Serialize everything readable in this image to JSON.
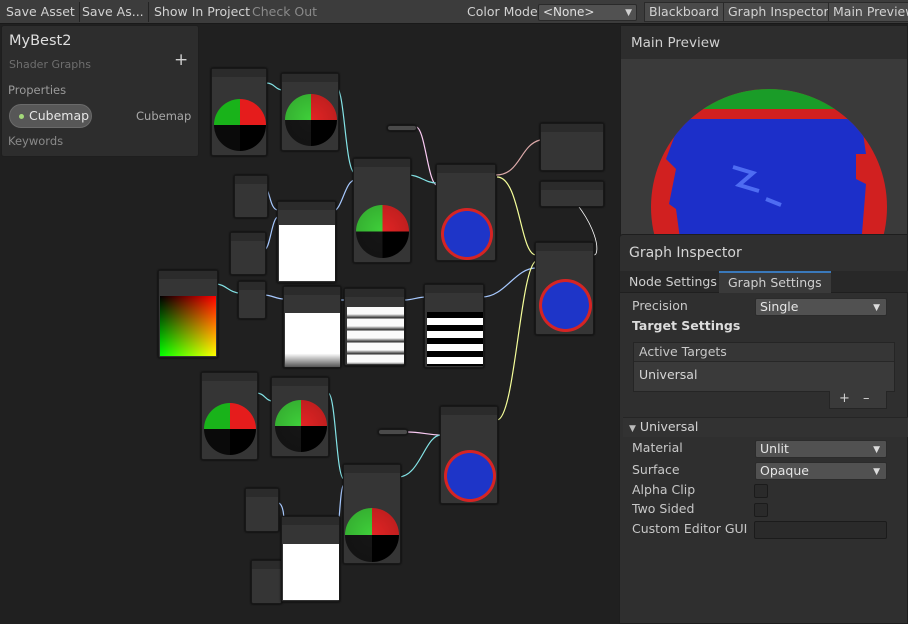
{
  "toolbar": {
    "save_asset": "Save Asset",
    "save_as": "Save As...",
    "show_in_project": "Show In Project",
    "check_out": "Check Out",
    "color_mode_label": "Color Mode",
    "color_mode_value": "<None>",
    "blackboard": "Blackboard",
    "graph_inspector": "Graph Inspector",
    "main_preview": "Main Preview"
  },
  "blackboard": {
    "title": "MyBest2",
    "subtitle": "Shader Graphs",
    "add_icon": "plus-icon",
    "properties_label": "Properties",
    "property": {
      "name": "Cubemap",
      "type": "Cubemap"
    },
    "keywords_label": "Keywords"
  },
  "main_preview": {
    "title": "Main Preview"
  },
  "inspector": {
    "title": "Graph Inspector",
    "tabs": [
      "Node Settings",
      "Graph Settings"
    ],
    "active_tab": "Graph Settings",
    "precision_label": "Precision",
    "precision_value": "Single",
    "target_settings_label": "Target Settings",
    "active_targets_label": "Active Targets",
    "active_targets": [
      "Universal"
    ],
    "add_label": "+",
    "remove_label": "–",
    "section_title": "Universal",
    "material_label": "Material",
    "material_value": "Unlit",
    "surface_label": "Surface",
    "surface_value": "Opaque",
    "alpha_clip_label": "Alpha Clip",
    "alpha_clip": false,
    "two_sided_label": "Two Sided",
    "two_sided": false,
    "custom_editor_label": "Custom Editor GUI",
    "custom_editor_value": ""
  },
  "colors": {
    "accent": "#3a79bb",
    "wire_vector": "#84e4e7",
    "wire_float": "#a7c9ff",
    "wire_vec3": "#f6ff9a",
    "wire_vec4": "#fbcbf4"
  }
}
